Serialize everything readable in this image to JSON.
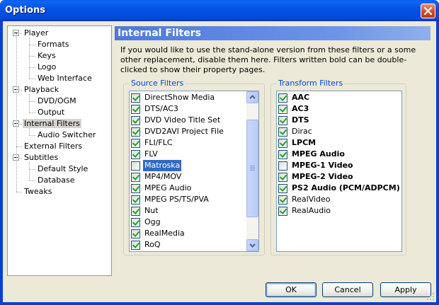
{
  "window": {
    "title": "Options"
  },
  "tree": {
    "items": [
      {
        "label": "Player",
        "level": 0,
        "expander": true
      },
      {
        "label": "Formats",
        "level": 1
      },
      {
        "label": "Keys",
        "level": 1
      },
      {
        "label": "Logo",
        "level": 1
      },
      {
        "label": "Web Interface",
        "level": 1
      },
      {
        "label": "Playback",
        "level": 0,
        "expander": true
      },
      {
        "label": "DVD/OGM",
        "level": 1
      },
      {
        "label": "Output",
        "level": 1
      },
      {
        "label": "Internal Filters",
        "level": 0,
        "expander": true,
        "selected": true
      },
      {
        "label": "Audio Switcher",
        "level": 1
      },
      {
        "label": "External Filters",
        "level": 0
      },
      {
        "label": "Subtitles",
        "level": 0,
        "expander": true
      },
      {
        "label": "Default Style",
        "level": 1
      },
      {
        "label": "Database",
        "level": 1
      },
      {
        "label": "Tweaks",
        "level": 0
      }
    ]
  },
  "panel": {
    "title": "Internal Filters",
    "description": "If you would like to use the stand-alone version from these filters or a some other replacement, disable them here. Filters written bold can be double-clicked to show their property pages."
  },
  "source": {
    "title": "Source Filters",
    "items": [
      {
        "label": "DirectShow Media",
        "checked": true
      },
      {
        "label": "DTS/AC3",
        "checked": true
      },
      {
        "label": "DVD Video Title Set",
        "checked": true
      },
      {
        "label": "DVD2AVI Project File",
        "checked": true
      },
      {
        "label": "FLI/FLC",
        "checked": true
      },
      {
        "label": "FLV",
        "checked": true
      },
      {
        "label": "Matroska",
        "checked": false,
        "selected": true
      },
      {
        "label": "MP4/MOV",
        "checked": true
      },
      {
        "label": "MPEG Audio",
        "checked": true
      },
      {
        "label": "MPEG PS/TS/PVA",
        "checked": true
      },
      {
        "label": "Nut",
        "checked": true
      },
      {
        "label": "Ogg",
        "checked": true
      },
      {
        "label": "RealMedia",
        "checked": true
      },
      {
        "label": "RoQ",
        "checked": true
      }
    ],
    "scroll_position": 0.42
  },
  "transform": {
    "title": "Transform Filters",
    "items": [
      {
        "label": "AAC",
        "checked": true,
        "bold": true
      },
      {
        "label": "AC3",
        "checked": true,
        "bold": true
      },
      {
        "label": "DTS",
        "checked": true,
        "bold": true
      },
      {
        "label": "Dirac",
        "checked": true,
        "bold": false
      },
      {
        "label": "LPCM",
        "checked": true,
        "bold": true
      },
      {
        "label": "MPEG Audio",
        "checked": true,
        "bold": true
      },
      {
        "label": "MPEG-1 Video",
        "checked": false,
        "bold": true
      },
      {
        "label": "MPEG-2 Video",
        "checked": true,
        "bold": true
      },
      {
        "label": "PS2 Audio (PCM/ADPCM)",
        "checked": true,
        "bold": true
      },
      {
        "label": "RealVideo",
        "checked": true,
        "bold": false
      },
      {
        "label": "RealAudio",
        "checked": true,
        "bold": false
      }
    ]
  },
  "buttons": {
    "ok": "OK",
    "cancel": "Cancel",
    "apply": "Apply"
  },
  "colors": {
    "title_bar": "#0348d8",
    "selection": "#316ac5",
    "header": "#4d7adb",
    "group_title": "#0046d5"
  }
}
